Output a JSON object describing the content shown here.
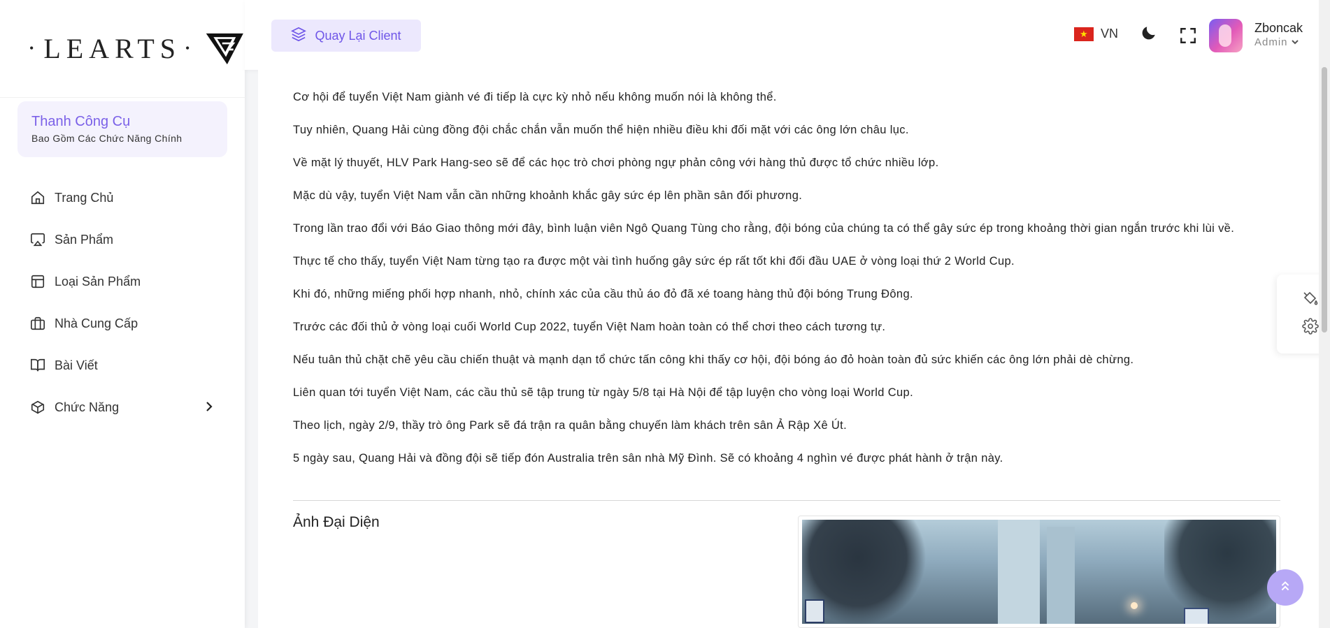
{
  "sidebar": {
    "logo_text": "LEARTS",
    "toolbox": {
      "title": "Thanh Công Cụ",
      "subtitle": "Bao Gồm Các Chức Năng Chính"
    },
    "items": [
      {
        "label": "Trang Chủ",
        "icon": "home-icon"
      },
      {
        "label": "Sản Phẩm",
        "icon": "airplay-icon"
      },
      {
        "label": "Loại Sản Phẩm",
        "icon": "layout-icon"
      },
      {
        "label": "Nhà Cung Cấp",
        "icon": "briefcase-icon"
      },
      {
        "label": "Bài Viết",
        "icon": "book-open-icon"
      },
      {
        "label": "Chức Năng",
        "icon": "box-icon",
        "has_children": true
      }
    ]
  },
  "header": {
    "back_button": "Quay Lại Client",
    "language": "VN",
    "user": {
      "name": "Zboncak",
      "role": "Admin"
    }
  },
  "article": {
    "paragraphs": [
      "Cơ hội để tuyển Việt Nam giành vé đi tiếp là cực kỳ nhỏ nếu không muốn nói là không thể.",
      "Tuy nhiên, Quang Hải cùng đồng đội chắc chắn vẫn muốn thể hiện nhiều điều khi đối mặt với các ông lớn châu lục.",
      "Về mặt lý thuyết, HLV Park Hang-seo sẽ để các học trò chơi phòng ngự phản công với hàng thủ được tổ chức nhiều lớp.",
      "Mặc dù vậy, tuyển Việt Nam vẫn cần những khoảnh khắc gây sức ép lên phần sân đối phương.",
      "Trong lần trao đổi với Báo Giao thông mới đây, bình luận viên Ngô Quang Tùng cho rằng, đội bóng của chúng ta có thể gây sức ép trong khoảng thời gian ngắn trước khi lùi về.",
      "Thực tế cho thấy, tuyển Việt Nam từng tạo ra được một vài tình huống gây sức ép rất tốt khi đối đầu UAE ở vòng loại thứ 2 World Cup.",
      "Khi đó, những miếng phối hợp nhanh, nhỏ, chính xác của cầu thủ áo đỏ đã xé toang hàng thủ đội bóng Trung Đông.",
      "Trước các đối thủ ở vòng loại cuối World Cup 2022, tuyển Việt Nam hoàn toàn có thể chơi theo cách tương tự.",
      "Nếu tuân thủ chặt chẽ yêu cầu chiến thuật và mạnh dạn tổ chức tấn công khi thấy cơ hội, đội bóng áo đỏ hoàn toàn đủ sức khiến các ông lớn phải dè chừng.",
      "Liên quan tới tuyển Việt Nam, các cầu thủ sẽ tập trung từ ngày 5/8 tại Hà Nội để tập luyện cho vòng loại World Cup.",
      "Theo lịch, ngày 2/9, thầy trò ông Park sẽ đá trận ra quân bằng chuyến làm khách trên sân Ả Rập Xê Út.",
      "5 ngày sau, Quang Hải và đồng đội sẽ tiếp đón Australia trên sân nhà Mỹ Đình. Sẽ có khoảng 4 nghìn vé được phát hành ở trận này."
    ],
    "image_label": "Ảnh Đại Diện"
  },
  "colors": {
    "accent": "#7b61e8",
    "accent_bg": "#ece8fd"
  }
}
